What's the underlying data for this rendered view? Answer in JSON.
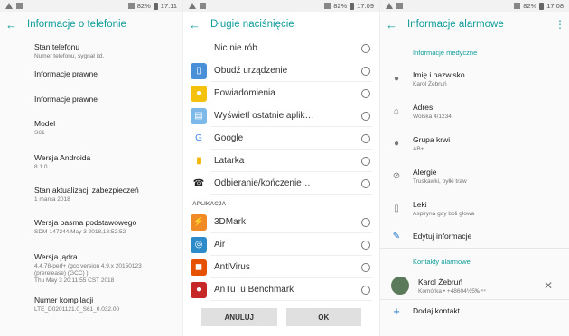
{
  "status": {
    "p1": {
      "battery": "82%",
      "time": "17:11"
    },
    "p2": {
      "battery": "82%",
      "time": "17:09"
    },
    "p3": {
      "battery": "82%",
      "time": "17:08"
    }
  },
  "phone_info": {
    "title": "Informacje o telefonie",
    "items": [
      {
        "title": "Stan telefonu",
        "sub": "Numer telefonu, sygnał itd."
      },
      {
        "title": "Informacje prawne",
        "sub": ""
      },
      {
        "title": "Informacje prawne",
        "sub": ""
      },
      {
        "title": "Model",
        "sub": "S61"
      },
      {
        "title": "Wersja Androida",
        "sub": "8.1.0"
      },
      {
        "title": "Stan aktualizacji zabezpieczeń",
        "sub": "1 marca 2018"
      },
      {
        "title": "Wersja pasma podstawowego",
        "sub": "SDM-147244,May  3 2018,18:52:52"
      },
      {
        "title": "Wersja jądra",
        "sub": "4.4.78-perf+ (gcc version 4.9.x 20150123\n(prerelease) (GCC) )\nThu May 3 20:11:55 CST 2018"
      },
      {
        "title": "Numer kompilacji",
        "sub": "LTE_D0201121.0_S61_0.032.00"
      }
    ]
  },
  "long_press": {
    "title": "Długie naciśnięcie",
    "options": [
      {
        "label": "Nic nie rób",
        "icon": "none"
      },
      {
        "label": "Obudź urządzenie",
        "icon": "phone-icon"
      },
      {
        "label": "Powiadomienia",
        "icon": "chat-bubble-icon"
      },
      {
        "label": "Wyświetl ostatnie aplik…",
        "icon": "recent-apps-icon"
      },
      {
        "label": "Google",
        "icon": "google-icon"
      },
      {
        "label": "Latarka",
        "icon": "flashlight-icon"
      },
      {
        "label": "Odbieranie/kończenie…",
        "icon": "call-icon"
      }
    ],
    "apps_header": "APLIKACJA",
    "apps": [
      {
        "label": "3DMark",
        "icon": "3dmark-icon"
      },
      {
        "label": "Air",
        "icon": "air-icon"
      },
      {
        "label": "AntiVirus",
        "icon": "antivirus-icon"
      },
      {
        "label": "AnTuTu Benchmark",
        "icon": "antutu-icon"
      }
    ],
    "cancel_label": "ANULUJ",
    "ok_label": "OK"
  },
  "emergency": {
    "title": "Informacje alarmowe",
    "medical_header": "Informacje medyczne",
    "items": [
      {
        "title": "Imię i nazwisko",
        "sub": "Karol Żebruń",
        "icon": "person-icon"
      },
      {
        "title": "Adres",
        "sub": "Wolska 4/1234",
        "icon": "home-icon"
      },
      {
        "title": "Grupa krwi",
        "sub": "AB+",
        "icon": "drop-icon"
      },
      {
        "title": "Alergie",
        "sub": "Truskawki, pyłki traw",
        "icon": "no-entry-icon"
      },
      {
        "title": "Leki",
        "sub": "Aspiryna gdy boli głowa",
        "icon": "medicine-icon"
      }
    ],
    "edit_label": "Edytuj informacje",
    "contacts_header": "Kontakty alarmowe",
    "contact": {
      "name": "Karol Żebruń",
      "sub": "Komórka • +48604½5‰⁴⁴"
    },
    "add_contact_label": "Dodaj kontakt"
  },
  "colors": {
    "accent": "#0f9d9a"
  }
}
